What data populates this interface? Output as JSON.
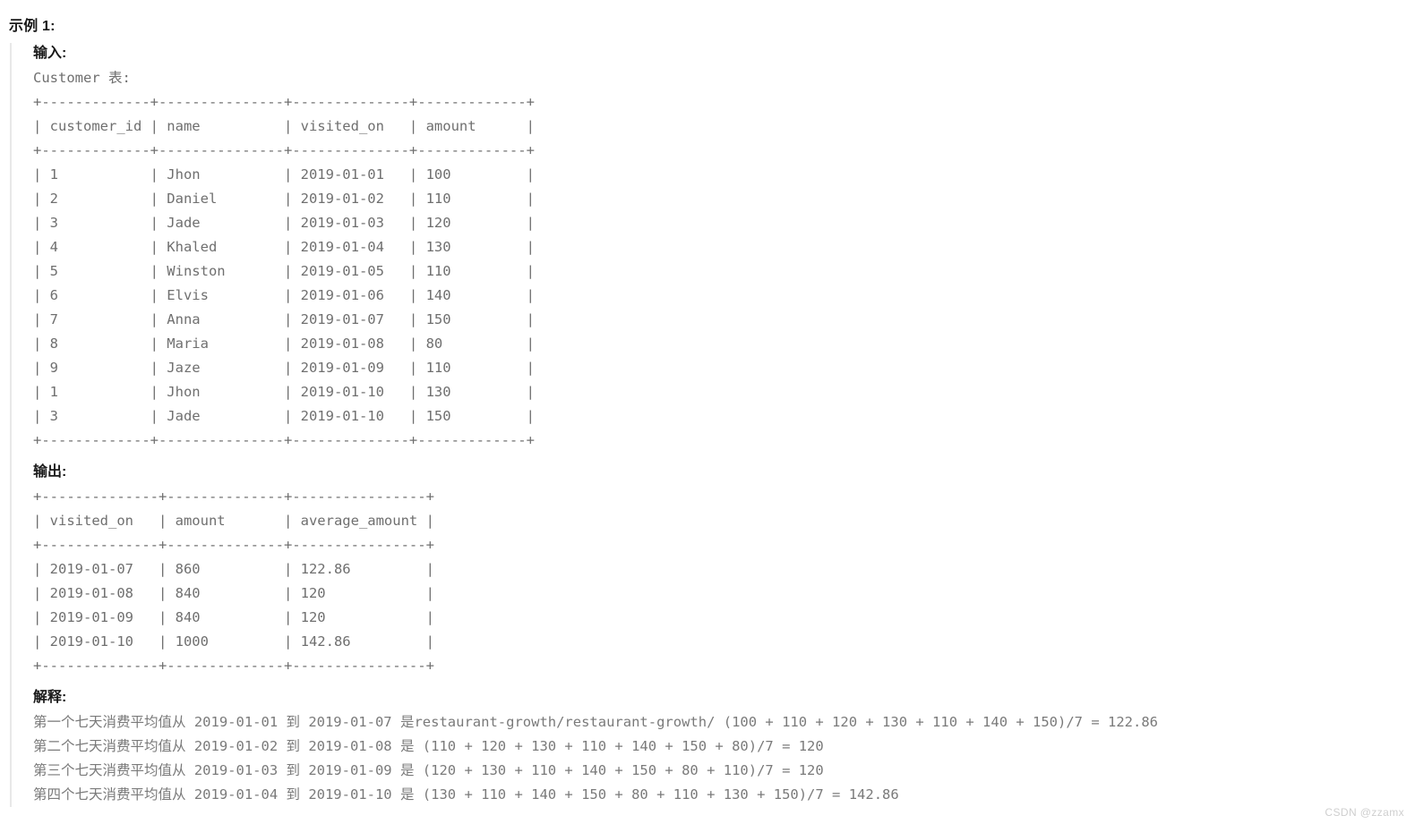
{
  "example_heading": "示例 1:",
  "input": {
    "label": "输入:",
    "table_caption": "Customer 表:",
    "separator": "+-------------+---------------+--------------+-------------+",
    "columns": [
      "customer_id",
      "name",
      "visited_on",
      "amount"
    ],
    "header_row": "| customer_id | name          | visited_on   | amount      |",
    "rows": [
      {
        "customer_id": "1",
        "name": "Jhon",
        "visited_on": "2019-01-01",
        "amount": "100"
      },
      {
        "customer_id": "2",
        "name": "Daniel",
        "visited_on": "2019-01-02",
        "amount": "110"
      },
      {
        "customer_id": "3",
        "name": "Jade",
        "visited_on": "2019-01-03",
        "amount": "120"
      },
      {
        "customer_id": "4",
        "name": "Khaled",
        "visited_on": "2019-01-04",
        "amount": "130"
      },
      {
        "customer_id": "5",
        "name": "Winston",
        "visited_on": "2019-01-05",
        "amount": "110"
      },
      {
        "customer_id": "6",
        "name": "Elvis",
        "visited_on": "2019-01-06",
        "amount": "140"
      },
      {
        "customer_id": "7",
        "name": "Anna",
        "visited_on": "2019-01-07",
        "amount": "150"
      },
      {
        "customer_id": "8",
        "name": "Maria",
        "visited_on": "2019-01-08",
        "amount": "80"
      },
      {
        "customer_id": "9",
        "name": "Jaze",
        "visited_on": "2019-01-09",
        "amount": "110"
      },
      {
        "customer_id": "1",
        "name": "Jhon",
        "visited_on": "2019-01-10",
        "amount": "130"
      },
      {
        "customer_id": "3",
        "name": "Jade",
        "visited_on": "2019-01-10",
        "amount": "150"
      }
    ],
    "block_text": "Customer 表:\n+-------------+---------------+--------------+-------------+\n| customer_id | name          | visited_on   | amount      |\n+-------------+---------------+--------------+-------------+\n| 1           | Jhon          | 2019-01-01   | 100         |\n| 2           | Daniel        | 2019-01-02   | 110         |\n| 3           | Jade          | 2019-01-03   | 120         |\n| 4           | Khaled        | 2019-01-04   | 130         |\n| 5           | Winston       | 2019-01-05   | 110         |\n| 6           | Elvis         | 2019-01-06   | 140         |\n| 7           | Anna          | 2019-01-07   | 150         |\n| 8           | Maria         | 2019-01-08   | 80          |\n| 9           | Jaze          | 2019-01-09   | 110         |\n| 1           | Jhon          | 2019-01-10   | 130         |\n| 3           | Jade          | 2019-01-10   | 150         |\n+-------------+---------------+--------------+-------------+"
  },
  "output": {
    "label": "输出:",
    "separator": "+--------------+--------------+----------------+",
    "columns": [
      "visited_on",
      "amount",
      "average_amount"
    ],
    "header_row": "| visited_on   | amount       | average_amount |",
    "rows": [
      {
        "visited_on": "2019-01-07",
        "amount": "860",
        "average_amount": "122.86"
      },
      {
        "visited_on": "2019-01-08",
        "amount": "840",
        "average_amount": "120"
      },
      {
        "visited_on": "2019-01-09",
        "amount": "840",
        "average_amount": "120"
      },
      {
        "visited_on": "2019-01-10",
        "amount": "1000",
        "average_amount": "142.86"
      }
    ],
    "block_text": "+--------------+--------------+----------------+\n| visited_on   | amount       | average_amount |\n+--------------+--------------+----------------+\n| 2019-01-07   | 860          | 122.86         |\n| 2019-01-08   | 840          | 120            |\n| 2019-01-09   | 840          | 120            |\n| 2019-01-10   | 1000         | 142.86         |\n+--------------+--------------+----------------+"
  },
  "explanation": {
    "label": "解释:",
    "lines": [
      "第一个七天消费平均值从 2019-01-01 到 2019-01-07 是restaurant-growth/restaurant-growth/ (100 + 110 + 120 + 130 + 110 + 140 + 150)/7 = 122.86",
      "第二个七天消费平均值从 2019-01-02 到 2019-01-08 是 (110 + 120 + 130 + 110 + 140 + 150 + 80)/7 = 120",
      "第三个七天消费平均值从 2019-01-03 到 2019-01-09 是 (120 + 130 + 110 + 140 + 150 + 80 + 110)/7 = 120",
      "第四个七天消费平均值从 2019-01-04 到 2019-01-10 是 (130 + 110 + 140 + 150 + 80 + 110 + 130 + 150)/7 = 142.86"
    ],
    "block_text": "第一个七天消费平均值从 2019-01-01 到 2019-01-07 是restaurant-growth/restaurant-growth/ (100 + 110 + 120 + 130 + 110 + 140 + 150)/7 = 122.86\n第二个七天消费平均值从 2019-01-02 到 2019-01-08 是 (110 + 120 + 130 + 110 + 140 + 150 + 80)/7 = 120\n第三个七天消费平均值从 2019-01-03 到 2019-01-09 是 (120 + 130 + 110 + 140 + 150 + 80 + 110)/7 = 120\n第四个七天消费平均值从 2019-01-04 到 2019-01-10 是 (130 + 110 + 140 + 150 + 80 + 110 + 130 + 150)/7 = 142.86"
  },
  "watermark": "CSDN @zzamx"
}
